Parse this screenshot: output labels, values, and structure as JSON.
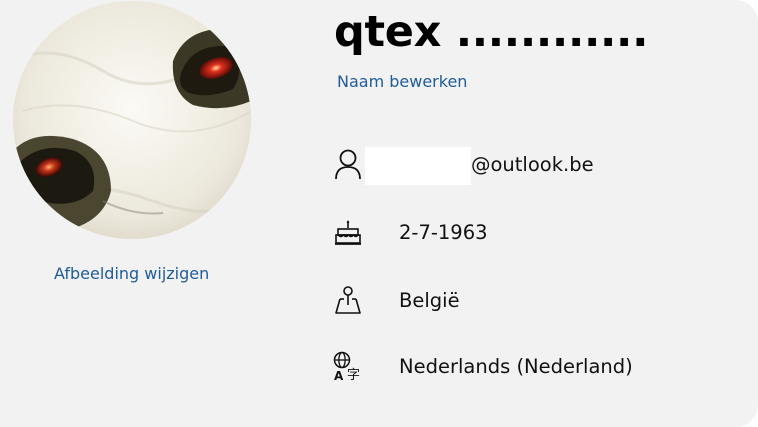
{
  "profile": {
    "name": "qtex ............",
    "edit_name_label": "Naam bewerken",
    "change_picture_label": "Afbeelding wijzigen"
  },
  "details": {
    "email_suffix": "@outlook.be",
    "birthdate": "2-7-1963",
    "country": "België",
    "language": "Nederlands (Nederland)"
  },
  "icons": {
    "account": "person-icon",
    "birthday": "cake-icon",
    "country": "map-pin-icon",
    "language": "language-icon"
  },
  "colors": {
    "link": "#1f5c99",
    "background": "#f2f2f2"
  }
}
